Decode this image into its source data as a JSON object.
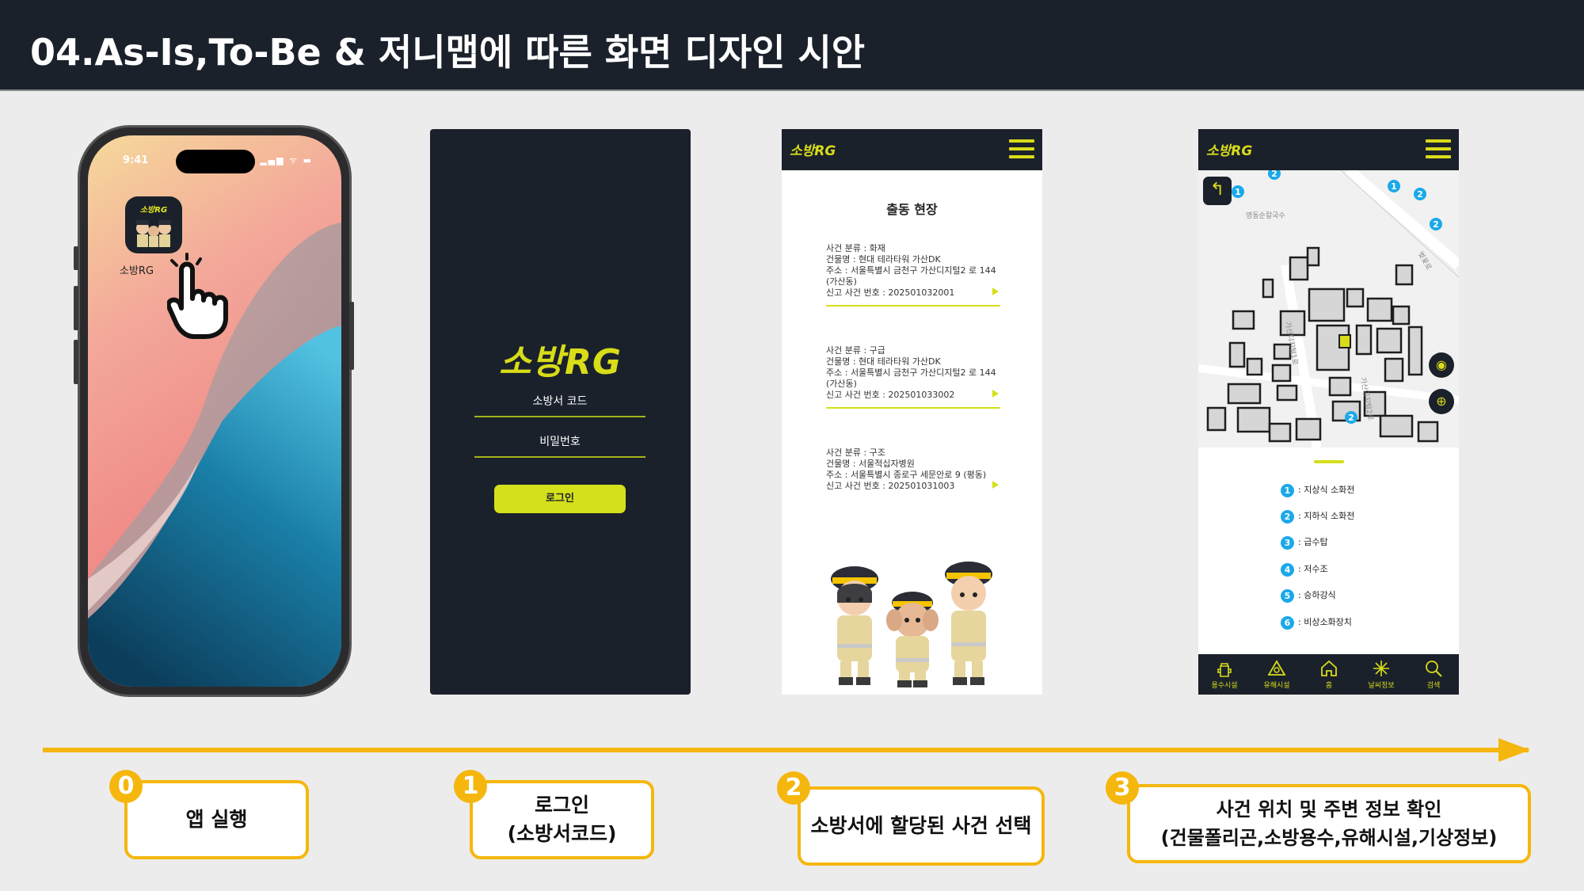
{
  "slide": {
    "title": "04.As-Is,To-Be & 저니맵에 따른 화면 디자인 시안"
  },
  "phone_home": {
    "status_time": "9:41",
    "status_icons": "▂▄▆ ᯤ ▬",
    "app_icon_logo": "소방RG",
    "app_label": "소방RG"
  },
  "login": {
    "logo": "소방RG",
    "station_code_label": "소방서 코드",
    "password_label": "비밀번호",
    "login_button": "로그인"
  },
  "app_bar": {
    "logo": "소방RG"
  },
  "incident_list": {
    "title": "출동 현장",
    "incidents": [
      {
        "category": "사건 분류 : 화재",
        "building": "건물명 : 현대 테라타워 가산DK",
        "address": "주소 : 서울특별시 금천구 가산디지털2 로 144 (가산동)",
        "report_no": "신고 사건 번호 : 202501032001"
      },
      {
        "category": "사건 분류 : 구급",
        "building": "건물명 : 현대 테라타워 가산DK",
        "address": "주소 : 서울특별시 금천구 가산디지털2 로 144 (가산동)",
        "report_no": "신고 사건 번호 : 202501033002"
      },
      {
        "category": "사건 분류 : 구조",
        "building": "건물명 : 서울적십자병원",
        "address": "주소 : 서울특별시 종로구 세문안로 9 (평동)",
        "report_no": "신고 사건 번호 : 202501031003"
      }
    ]
  },
  "map_screen": {
    "map_labels": [
      "영동순칼국수",
      "가산디지털1로",
      "가산디지털2로",
      "벚꽃로"
    ],
    "legend": [
      {
        "num": "1",
        "label": ": 지상식 소화전"
      },
      {
        "num": "2",
        "label": ": 지하식 소화전"
      },
      {
        "num": "3",
        "label": ": 급수탑"
      },
      {
        "num": "4",
        "label": ": 저수조"
      },
      {
        "num": "5",
        "label": ": 승하강식"
      },
      {
        "num": "6",
        "label": ": 비상소화장치"
      }
    ],
    "bottom_nav": [
      "용수시설",
      "유해시설",
      "홈",
      "날씨정보",
      "검색"
    ],
    "marker_color": "#1aa9e9"
  },
  "steps": [
    {
      "num": "0",
      "label_line1": "앱 실행",
      "label_line2": ""
    },
    {
      "num": "1",
      "label_line1": "로그인",
      "label_line2": "(소방서코드)"
    },
    {
      "num": "2",
      "label_line1": "소방서에 할당된 사건 선택",
      "label_line2": ""
    },
    {
      "num": "3",
      "label_line1": "사건 위치 및 주변 정보 확인",
      "label_line2": "(건물폴리곤,소방용수,유해시설,기상정보)"
    }
  ],
  "colors": {
    "dark": "#1b212b",
    "accent_yellow_green": "#d8dc19",
    "timeline_orange": "#f5b70e",
    "marker_blue": "#1aa9e9"
  }
}
